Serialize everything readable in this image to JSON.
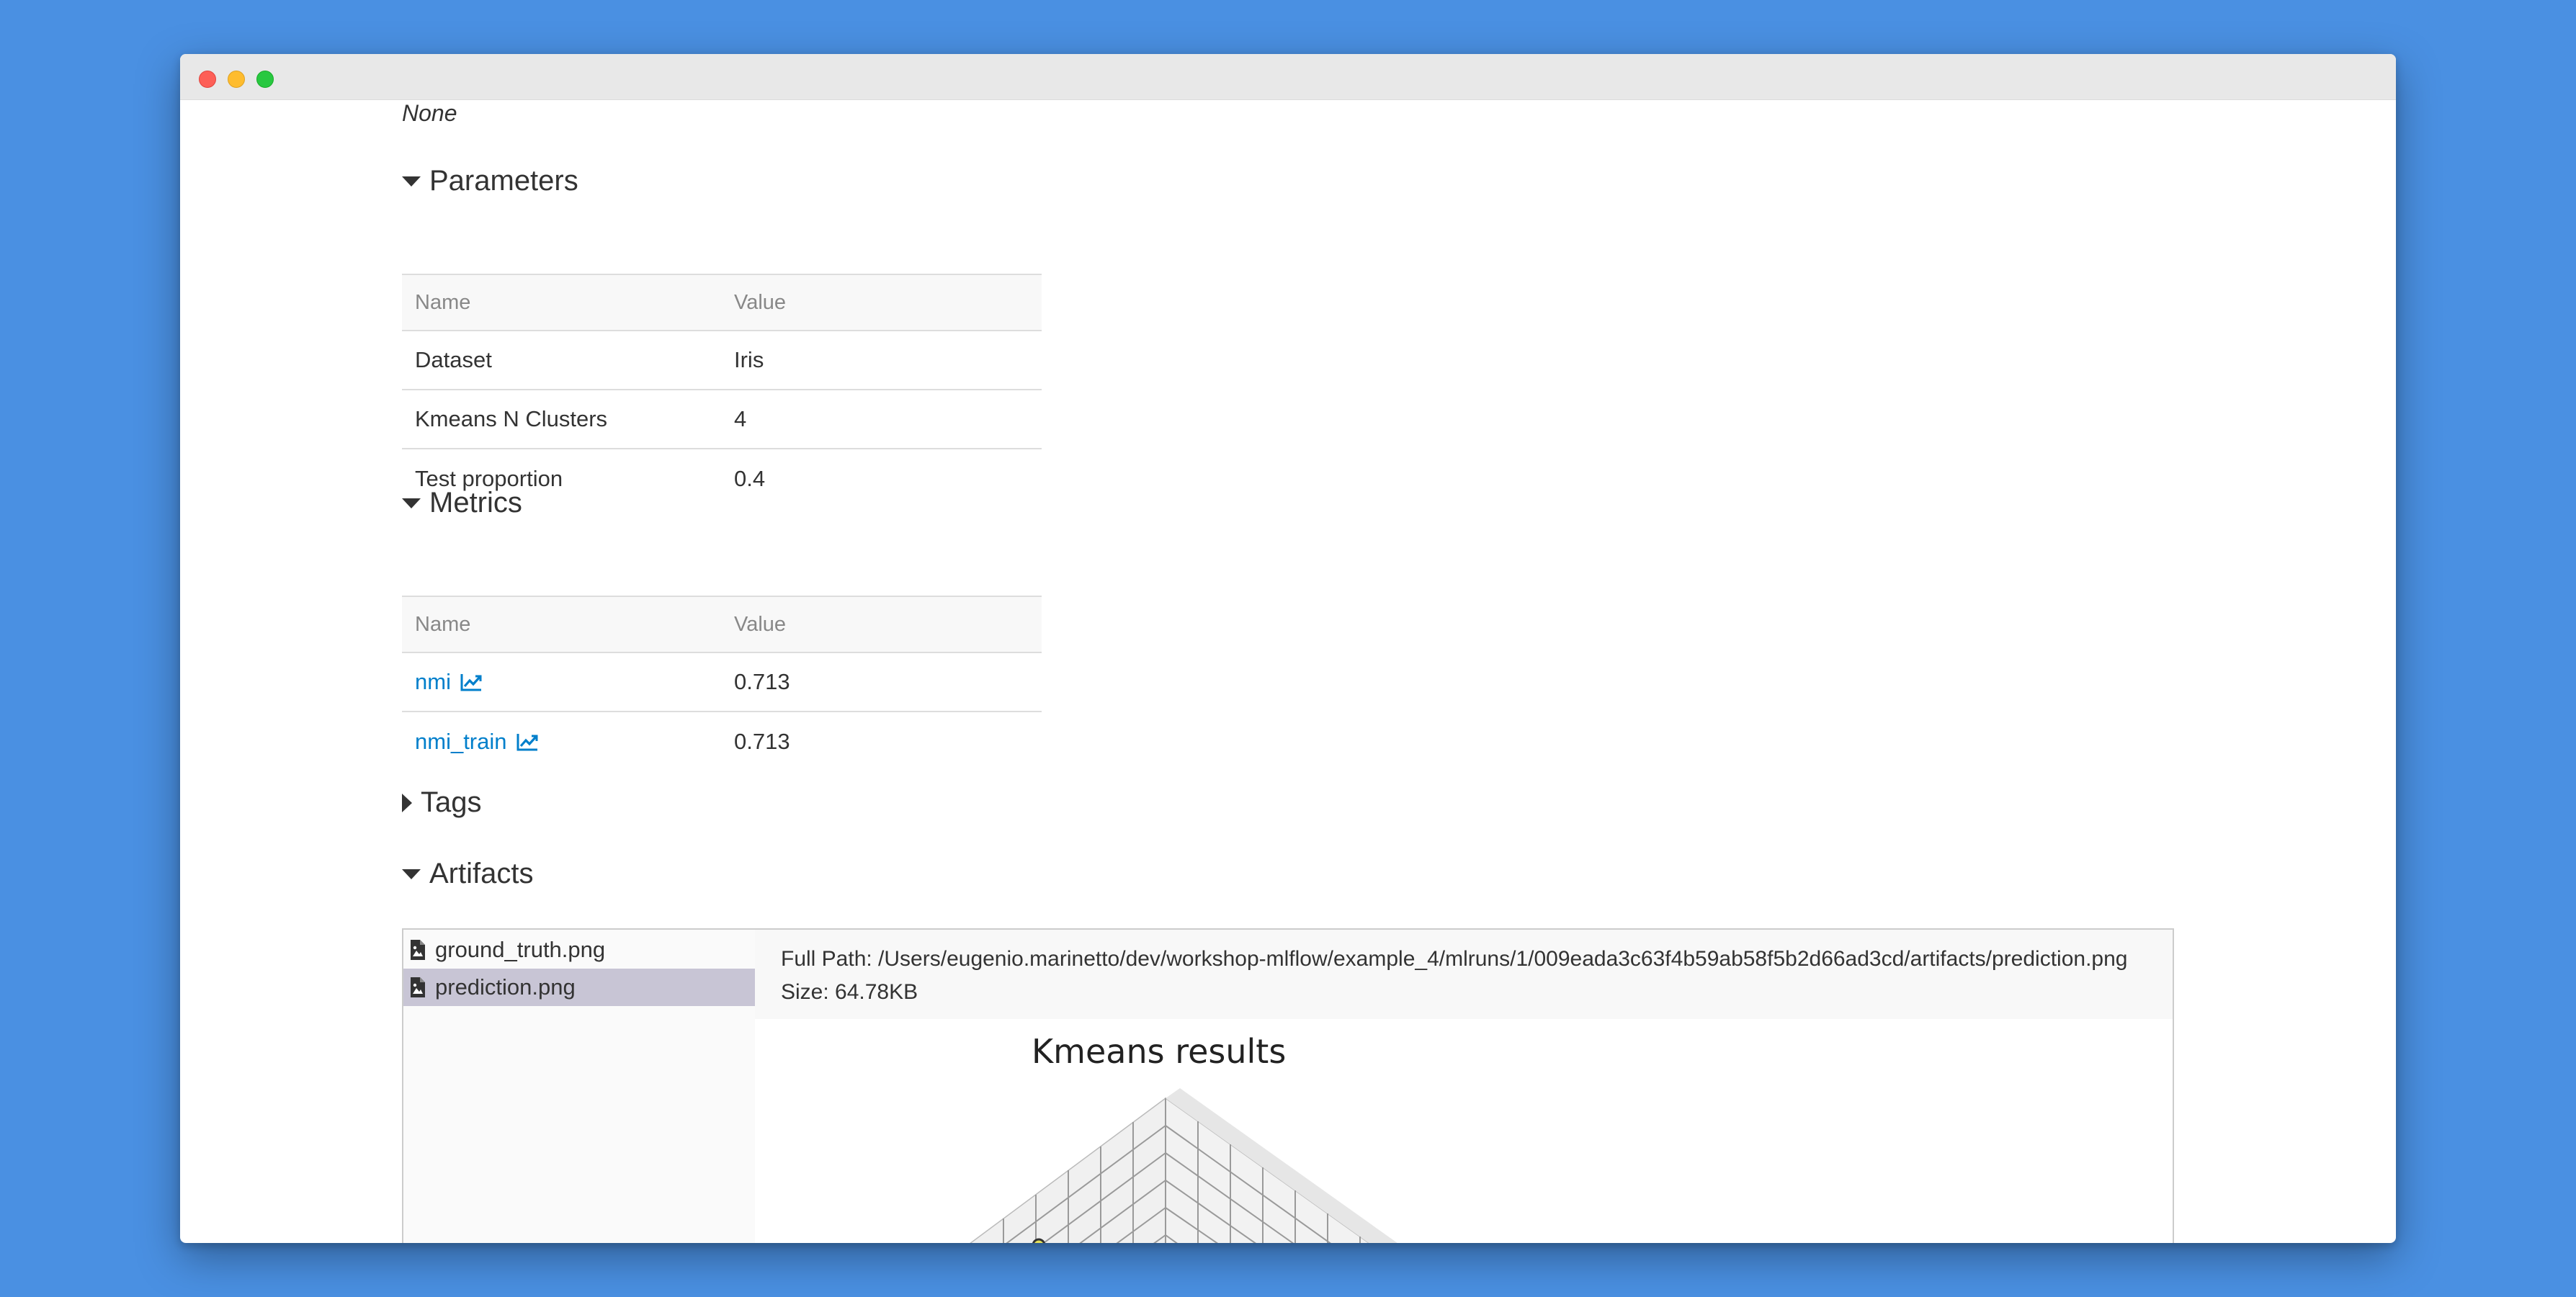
{
  "run": {
    "description_value": "None"
  },
  "parameters": {
    "title": "Parameters",
    "columns": [
      "Name",
      "Value"
    ],
    "rows": [
      {
        "name": "Dataset",
        "value": "Iris"
      },
      {
        "name": "Kmeans N Clusters",
        "value": "4"
      },
      {
        "name": "Test proportion",
        "value": "0.4"
      }
    ]
  },
  "metrics": {
    "title": "Metrics",
    "columns": [
      "Name",
      "Value"
    ],
    "rows": [
      {
        "name": "nmi",
        "value": "0.713",
        "icon": "line-chart-icon"
      },
      {
        "name": "nmi_train",
        "value": "0.713",
        "icon": "line-chart-icon"
      }
    ],
    "link_color": "#017fcb"
  },
  "tags": {
    "title": "Tags"
  },
  "artifacts": {
    "title": "Artifacts",
    "files": [
      {
        "name": "ground_truth.png",
        "icon": "image-file-icon",
        "selected": false
      },
      {
        "name": "prediction.png",
        "icon": "image-file-icon",
        "selected": true
      }
    ],
    "full_path": "Full Path: /Users/eugenio.marinetto/dev/workshop-mlflow/example_4/mlruns/1/009eada3c63f4b59ab58f5b2d66ad3cd/artifacts/prediction.png",
    "size": "Size: 64.78KB",
    "preview_title": "Kmeans results",
    "selected_color": "#c8c5d5"
  }
}
